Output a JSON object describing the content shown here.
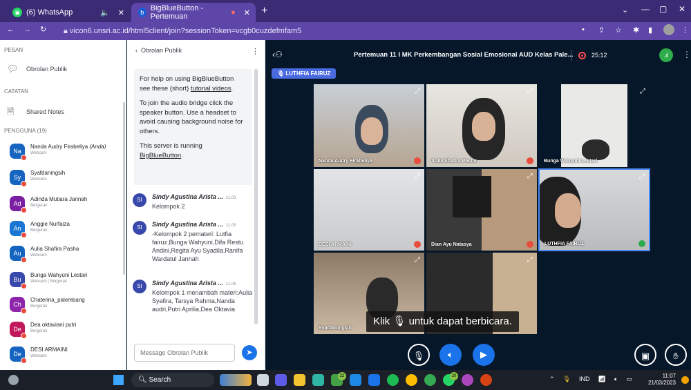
{
  "browser": {
    "tabs": [
      {
        "label": "(6) WhatsApp",
        "icon": "whatsapp-icon"
      },
      {
        "label": "BigBlueButton - Pertemuan",
        "icon": "bigbluebutton-icon"
      }
    ],
    "url": "vicon6.unsri.ac.id/html5client/join?sessionToken=vcgb0cuzdefmfam5"
  },
  "left": {
    "messages_header": "PESAN",
    "public_chat": "Obrolan Publik",
    "notes_header": "CATATAN",
    "shared_notes": "Shared Notes",
    "users_header": "PENGGUNA (19)",
    "users": [
      {
        "initials": "Na",
        "name": "Nanda Audry Firabeliya",
        "suffix": "(Anda)",
        "status": "Webcam",
        "color": "#1565c0"
      },
      {
        "initials": "Sy",
        "name": "Syafdaningsih",
        "suffix": "",
        "status": "Webcam",
        "color": "#1565c0"
      },
      {
        "initials": "Ad",
        "name": "Adinda Mutiara Jannah",
        "suffix": "",
        "status": "Bergerak",
        "color": "#7b1fa2"
      },
      {
        "initials": "An",
        "name": "Anggie Nurfaiza",
        "suffix": "",
        "status": "Bergerak",
        "color": "#1976d2"
      },
      {
        "initials": "Au",
        "name": "Aulia Shafira Pasha",
        "suffix": "",
        "status": "Webcam",
        "color": "#1565c0"
      },
      {
        "initials": "Bu",
        "name": "Bunga Wahyuni Lestari",
        "suffix": "",
        "status": "Webcam | Bergerak",
        "color": "#3949ab"
      },
      {
        "initials": "Ch",
        "name": "Chaterina_palembang",
        "suffix": "",
        "status": "Bergerak",
        "color": "#8e24aa"
      },
      {
        "initials": "De",
        "name": "Dea oktaviani putri",
        "suffix": "",
        "status": "Bergerak",
        "color": "#c2185b"
      },
      {
        "initials": "De",
        "name": "DESI ARMAINI",
        "suffix": "",
        "status": "Webcam",
        "color": "#1565c0"
      }
    ]
  },
  "chat": {
    "title": "Obrolan Publik",
    "welcome": {
      "p1_pre": "For help on using BigBlueButton see these (short) ",
      "p1_link": "tutorial videos",
      "p1_post": ".",
      "p2": "To join the audio bridge click the speaker button. Use a headset to avoid causing background noise for others.",
      "p3_pre": "This server is running ",
      "p3_link": "BigBlueButton",
      "p3_post": "."
    },
    "messages": [
      {
        "initials": "SI",
        "name": "Sindy Agustina Arista ...",
        "time": "11.03",
        "text": "Kelompok 2"
      },
      {
        "initials": "SI",
        "name": "Sindy Agustina Arista ...",
        "time": "11.05",
        "text": "-Kelompok 2 pemateri: Lutfia fairuz,Bunga Wahyuni,Difa Restu Andini,Regita Ayu Syadila,Ranifa Wardatul Jannah"
      },
      {
        "initials": "SI",
        "name": "Sindy Agustina Arista ...",
        "time": "11.06",
        "text": "Kelompok 1 menambah materi:Aulia Syafira, Tarsya Rahma,Nanda audri,Putri Aprilia,Dea Oktavia"
      }
    ],
    "input_placeholder": "Message Obrolan Publik"
  },
  "meeting": {
    "title": "Pertemuan 11 I MK Perkembangan Sosial Emosional AUD Kelas Pale...",
    "timer": "25:12",
    "talking": "LUTHFIA FAIRUZ",
    "tiles": [
      {
        "name": "Nanda Audry Firabeliya"
      },
      {
        "name": "Aulia Shafira Pasha"
      },
      {
        "name": "Bunga Wahyuni Lestari"
      },
      {
        "name": "DESI ARMAINI"
      },
      {
        "name": "Dian Ayu Natasya"
      },
      {
        "name": "LUTHFIA FAIRUZ"
      },
      {
        "name": "Syafdaningsih"
      },
      {
        "name": ""
      }
    ],
    "caption_pre": "Klik",
    "caption_post": "untuk dapat berbicara."
  },
  "taskbar": {
    "search": "Search",
    "lang": "IND",
    "time": "11:07",
    "date": "21/03/2023",
    "badges": [
      "22",
      "20"
    ]
  }
}
